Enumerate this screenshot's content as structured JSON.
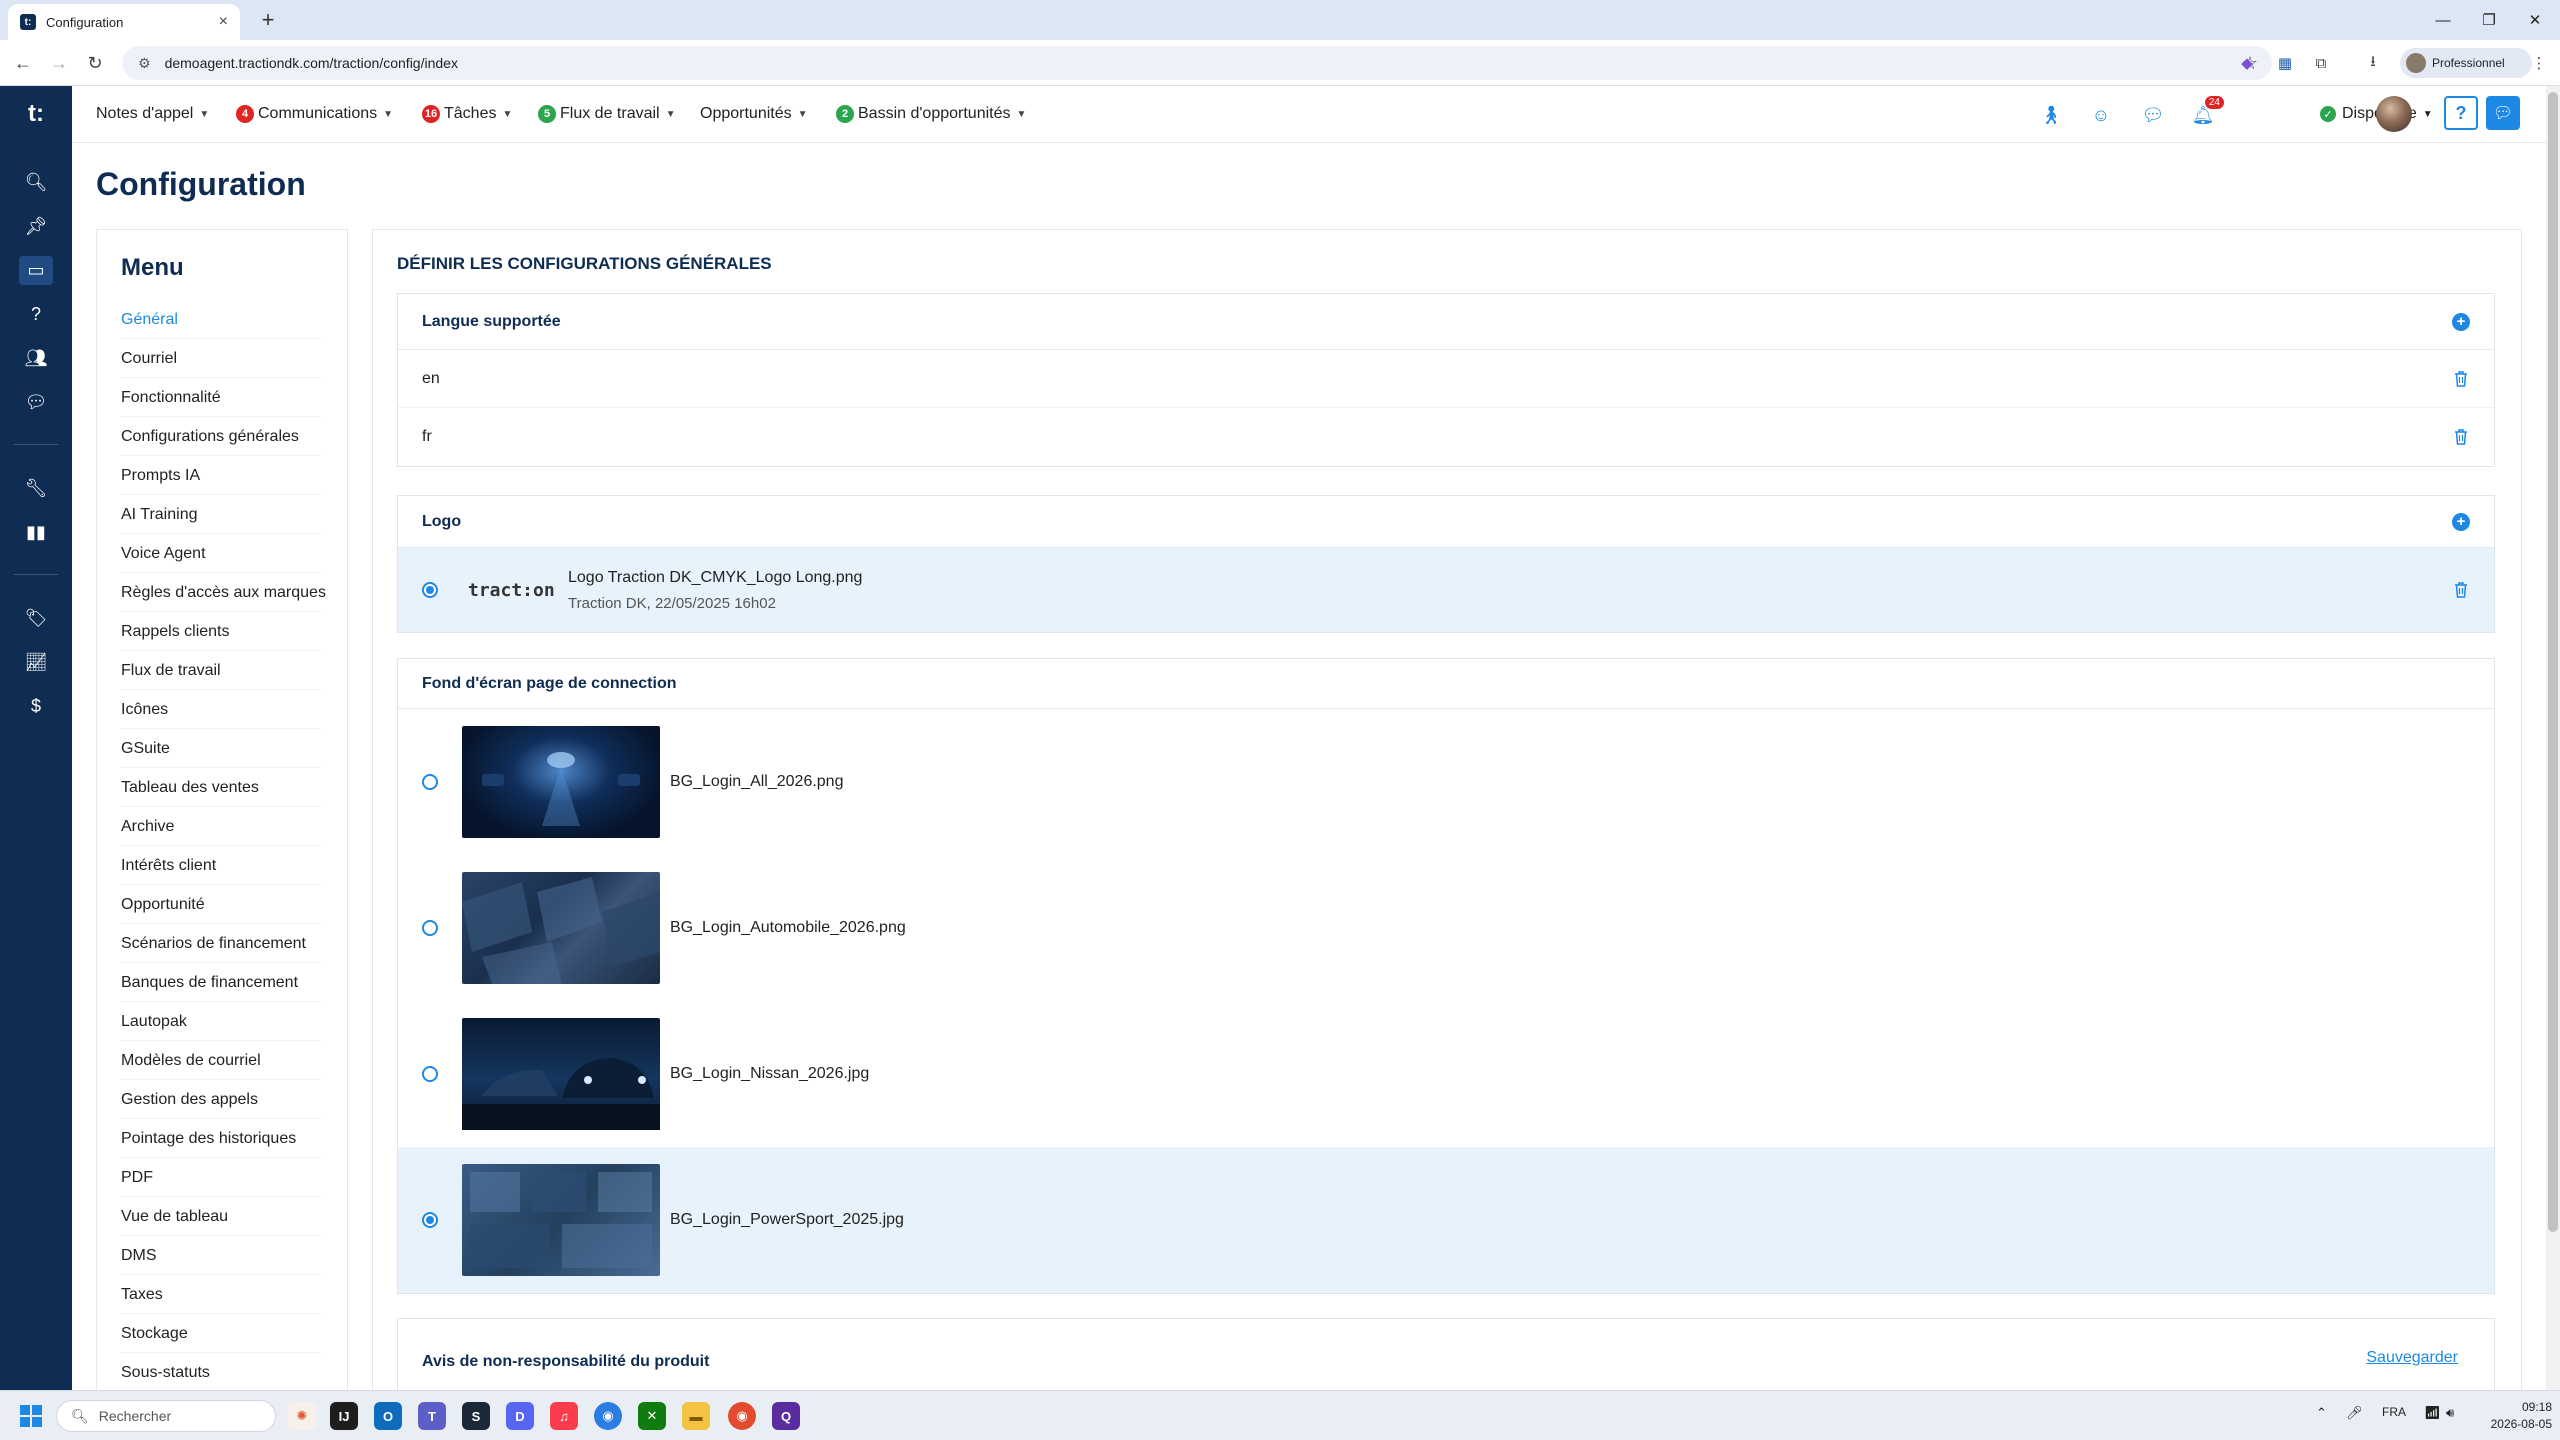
{
  "browser": {
    "tab_title": "Configuration",
    "tab_favicon": "t:",
    "url": "demoagent.tractiondk.com/traction/config/index",
    "profile_label": "Professionnel",
    "new_tab_icon": "plus-icon"
  },
  "topnav": {
    "items": [
      {
        "label": "Notes d'appel",
        "badge": null
      },
      {
        "label": "Communications",
        "badge": "4",
        "badge_color": "#e02424"
      },
      {
        "label": "Tâches",
        "badge": "16",
        "badge_color": "#e02424"
      },
      {
        "label": "Flux de travail",
        "badge": "5",
        "badge_color": "#2da44e"
      },
      {
        "label": "Opportunités",
        "badge": null
      },
      {
        "label": "Bassin d'opportunités",
        "badge": "2",
        "badge_color": "#2da44e"
      }
    ],
    "notification_count": "24",
    "status_label": "Disponible",
    "help_label": "?"
  },
  "rail": {
    "logo": "t:",
    "icons": [
      "search-icon",
      "pin-icon",
      "monitor-icon",
      "help-icon",
      "users-icon",
      "chat-icon",
      "wrench-icon",
      "map-icon",
      "tag-icon",
      "chart-icon",
      "dollar-icon"
    ]
  },
  "page": {
    "title": "Configuration"
  },
  "menu": {
    "heading": "Menu",
    "items": [
      "Général",
      "Courriel",
      "Fonctionnalité",
      "Configurations générales",
      "Prompts IA",
      "AI Training",
      "Voice Agent",
      "Règles d'accès aux marques",
      "Rappels clients",
      "Flux de travail",
      "Icônes",
      "GSuite",
      "Tableau des ventes",
      "Archive",
      "Intérêts client",
      "Opportunité",
      "Scénarios de financement",
      "Banques de financement",
      "Lautopak",
      "Modèles de courriel",
      "Gestion des appels",
      "Pointage des historiques",
      "PDF",
      "Vue de tableau",
      "DMS",
      "Taxes",
      "Stockage",
      "Sous-statuts"
    ],
    "active_index": 0
  },
  "content": {
    "section_title": "DÉFINIR LES CONFIGURATIONS GÉNÉRALES",
    "languages": {
      "heading": "Langue supportée",
      "items": [
        "en",
        "fr"
      ]
    },
    "logo": {
      "heading": "Logo",
      "preview_text": "tract:on",
      "file_name": "Logo Traction DK_CMYK_Logo Long.png",
      "meta": "Traction DK, 22/05/2025 16h02",
      "selected": true
    },
    "backgrounds": {
      "heading": "Fond d'écran page de connection",
      "items": [
        {
          "name": "BG_Login_All_2026.png",
          "selected": false
        },
        {
          "name": "BG_Login_Automobile_2026.png",
          "selected": false
        },
        {
          "name": "BG_Login_Nissan_2026.jpg",
          "selected": false
        },
        {
          "name": "BG_Login_PowerSport_2025.jpg",
          "selected": true
        }
      ]
    },
    "disclaimer": {
      "heading": "Avis de non-responsabilité du produit",
      "save_label": "Sauvegarder"
    }
  },
  "taskbar": {
    "search_placeholder": "Rechercher",
    "language": "FRA",
    "time": "09:18",
    "date": "2026-08-05"
  },
  "colors": {
    "brand_navy": "#0f2c52",
    "accent_blue": "#1e88e5",
    "selected_row": "#e8f2fc"
  }
}
